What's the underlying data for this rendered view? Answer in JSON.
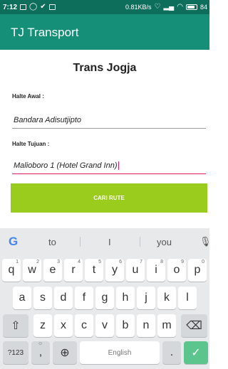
{
  "status": {
    "time": "7:12",
    "speed": "0.81KB/s",
    "battery": "84",
    "battery_level": 0.84
  },
  "app": {
    "title": "TJ Transport"
  },
  "page": {
    "title": "Trans Jogja",
    "origin_label": "Halte Awal :",
    "origin_value": "Bandara Adisutjipto",
    "destination_label": "Halte Tujuan :",
    "destination_value": "Malioboro 1 (Hotel Grand Inn)",
    "search_button": "CARI RUTE"
  },
  "keyboard": {
    "suggestions": [
      "to",
      "I",
      "you"
    ],
    "row1": [
      {
        "k": "q",
        "h": "1"
      },
      {
        "k": "w",
        "h": "2"
      },
      {
        "k": "e",
        "h": "3"
      },
      {
        "k": "r",
        "h": "4"
      },
      {
        "k": "t",
        "h": "5"
      },
      {
        "k": "y",
        "h": "6"
      },
      {
        "k": "u",
        "h": "7"
      },
      {
        "k": "i",
        "h": "8"
      },
      {
        "k": "o",
        "h": "9"
      },
      {
        "k": "p",
        "h": "0"
      }
    ],
    "row2": [
      "a",
      "s",
      "d",
      "f",
      "g",
      "h",
      "j",
      "k",
      "l"
    ],
    "row3": [
      "z",
      "x",
      "c",
      "v",
      "b",
      "n",
      "m"
    ],
    "symbols_key": "?123",
    "comma_key": ",",
    "space_label": "English",
    "period_key": "."
  },
  "colors": {
    "statusbar": "#0e6e5c",
    "appbar": "#168f78",
    "button": "#99cc1c",
    "focus_underline": "#e0205a",
    "enter_key": "#5cc58e"
  }
}
